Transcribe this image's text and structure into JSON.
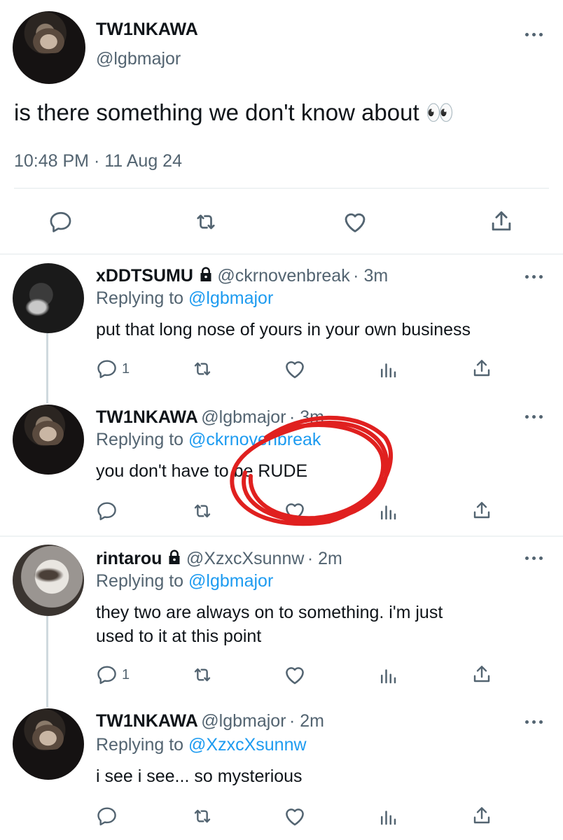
{
  "main_tweet": {
    "name": "TW1NKAWA",
    "handle": "@lgbmajor",
    "text": "is there something we don't know about",
    "emoji": "👀",
    "timestamp": "10:48 PM · 11 Aug 24"
  },
  "replies": [
    {
      "name": "xDDTSUMU",
      "locked": true,
      "handle": "@ckrnovenbreak",
      "time": "· 3m",
      "replying_prefix": "Replying to",
      "replying_handle": "@lgbmajor",
      "text": "put that long nose of yours in your own business",
      "reply_count": "1"
    },
    {
      "name": "TW1NKAWA",
      "handle": "@lgbmajor",
      "time": "· 3m",
      "replying_prefix": "Replying to",
      "replying_handle": "@ckrnovenbreak",
      "text": "you don't have to be RUDE",
      "reply_count": ""
    },
    {
      "name": "rintarou",
      "locked": true,
      "handle": "@XzxcXsunnw",
      "time": "· 2m",
      "replying_prefix": "Replying to",
      "replying_handle": "@lgbmajor",
      "text_line1": "they two are always on to something. i'm just",
      "text_line2": "used to it at this point",
      "reply_count": "1"
    },
    {
      "name": "TW1NKAWA",
      "handle": "@lgbmajor",
      "time": "· 2m",
      "replying_prefix": "Replying to",
      "replying_handle": "@XzxcXsunnw",
      "text": "i see i see... so mysterious",
      "reply_count": ""
    }
  ],
  "colors": {
    "text": "#0f1419",
    "secondary": "#536471",
    "link": "#1d9bf0",
    "annotation_circle": "#e0201f"
  },
  "icons": [
    "reply-icon",
    "retweet-icon",
    "like-icon",
    "share-icon",
    "analytics-icon",
    "more-icon",
    "lock-icon"
  ]
}
